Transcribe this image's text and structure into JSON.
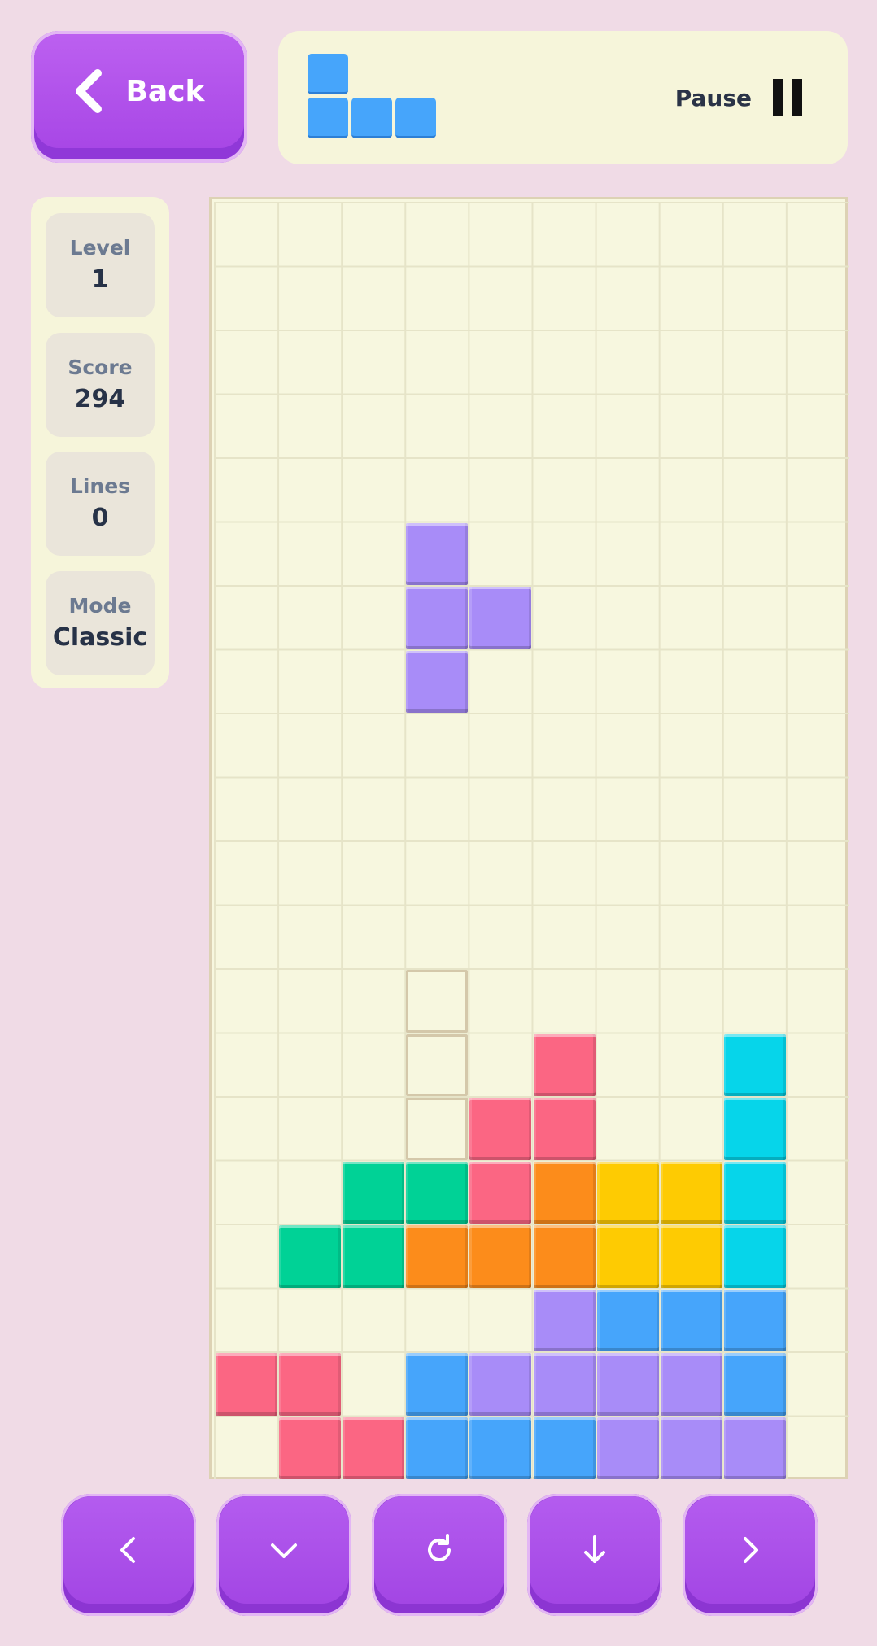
{
  "back_button": {
    "label": "Back",
    "icon": "chevron-left-icon"
  },
  "next_piece": {
    "color": "#46a5fb"
  },
  "pause_button": {
    "label": "Pause",
    "icon": "pause-icon"
  },
  "stats": [
    {
      "label": "Level",
      "value": "1"
    },
    {
      "label": "Score",
      "value": "294"
    },
    {
      "label": "Lines",
      "value": "0"
    },
    {
      "label": "Mode",
      "value": "Classic"
    }
  ],
  "board": {
    "columns": 10,
    "rows": 20,
    "colors": {
      "P": "#a88cf8",
      "R": "#fb6683",
      "C": "#06d5ea",
      "G": "#00d296",
      "O": "#fc8c1b",
      "Y": "#fecb02",
      "B": "#46a5fb"
    },
    "active_piece": {
      "color": "P",
      "cells": [
        [
          3,
          5
        ],
        [
          3,
          6
        ],
        [
          4,
          6
        ],
        [
          3,
          7
        ]
      ]
    },
    "ghost_cells": [
      [
        3,
        12
      ],
      [
        3,
        13
      ],
      [
        3,
        14
      ]
    ],
    "locked_rows": [
      "..........",
      "..........",
      "..........",
      "..........",
      "..........",
      "..........",
      "..........",
      "..........",
      "..........",
      "..........",
      "..........",
      "..........",
      "..........",
      ".....R..C.",
      "....RR..C.",
      "..GGROYYC.",
      ".GGOOOYYC.",
      ".....PBBB.",
      "RR.BPPPPB.",
      ".RRBBBPPP."
    ]
  },
  "controls": [
    {
      "action": "move-left",
      "icon": "chevron-left-icon"
    },
    {
      "action": "soft-drop",
      "icon": "chevron-down-icon"
    },
    {
      "action": "rotate",
      "icon": "rotate-icon"
    },
    {
      "action": "hard-drop",
      "icon": "arrow-down-icon"
    },
    {
      "action": "move-right",
      "icon": "chevron-right-icon"
    }
  ]
}
